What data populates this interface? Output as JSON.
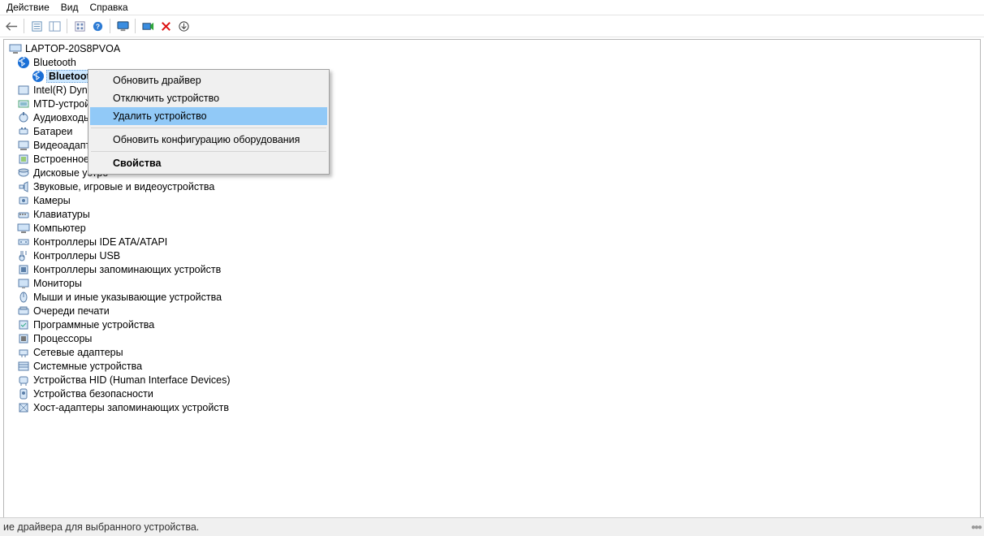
{
  "menu": {
    "action": "Действие",
    "view": "Вид",
    "help": "Справка"
  },
  "toolbar_icons": {
    "back": "back-icon",
    "props": "properties-icon",
    "refresh": "refresh-icon",
    "panes": "panes-icon",
    "help": "help-icon",
    "monitor": "monitor-icon",
    "scan": "scan-hardware-icon",
    "remove": "remove-icon",
    "download": "download-icon"
  },
  "tree": {
    "root": "LAPTOP-20S8PVOA",
    "bluetooth": "Bluetooth",
    "bluetooth_module": "Bluetooth USB Module",
    "categories": [
      "Intel(R) Dynami",
      "MTD-устройст",
      "Аудиовходы и а",
      "Батареи",
      "Видеоадаптер",
      "Встроенное ПО",
      "Дисковые устро",
      "Звуковые, игровые и видеоустройства",
      "Камеры",
      "Клавиатуры",
      "Компьютер",
      "Контроллеры IDE ATA/ATAPI",
      "Контроллеры USB",
      "Контроллеры запоминающих устройств",
      "Мониторы",
      "Мыши и иные указывающие устройства",
      "Очереди печати",
      "Программные устройства",
      "Процессоры",
      "Сетевые адаптеры",
      "Системные устройства",
      "Устройства HID (Human Interface Devices)",
      "Устройства безопасности",
      "Хост-адаптеры запоминающих устройств"
    ]
  },
  "context_menu": {
    "update_driver": "Обновить драйвер",
    "disable_device": "Отключить устройство",
    "uninstall_device": "Удалить устройство",
    "scan_hardware": "Обновить конфигурацию оборудования",
    "properties": "Свойства"
  },
  "statusbar": {
    "text": "ие драйвера для выбранного устройства."
  },
  "colors": {
    "highlight": "#91c9f7",
    "selection": "#cde8ff"
  }
}
